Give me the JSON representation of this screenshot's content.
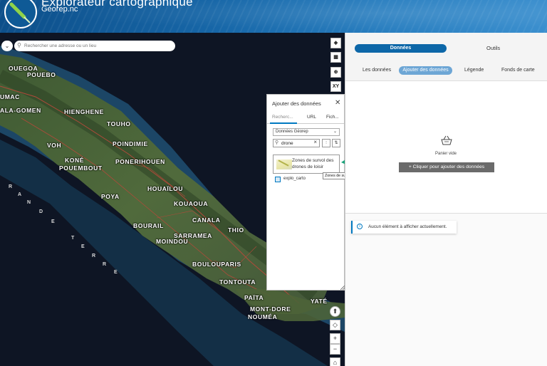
{
  "header": {
    "title": "Explorateur cartographique",
    "subtitle": "Géorep.nc"
  },
  "map": {
    "search_placeholder": "Rechercher une adresse ou un lieu",
    "search_toggle_icon": "chevron-down-icon",
    "tools": [
      {
        "name": "layers-icon",
        "glyph": "◈"
      },
      {
        "name": "qr-code-icon",
        "glyph": "▦"
      },
      {
        "name": "add-circle-icon",
        "glyph": "⊕"
      },
      {
        "name": "xy-button",
        "glyph": "XY"
      }
    ],
    "nav": [
      {
        "name": "compass-icon",
        "glyph": "⬆"
      },
      {
        "name": "locate-icon",
        "glyph": "◇"
      },
      {
        "name": "zoom-in-button",
        "glyph": "+"
      },
      {
        "name": "zoom-out-button",
        "glyph": "−"
      },
      {
        "name": "home-icon",
        "glyph": "⌂"
      }
    ],
    "places": [
      "OUEGOA",
      "POUEBO",
      "UMAC",
      "ALA-GOMEN",
      "HIENGHENE",
      "TOUHO",
      "VOH",
      "POINDIMIE",
      "KONÉ",
      "POUEMBOUT",
      "PONERIHOUEN",
      "POYA",
      "HOUAÏLOU",
      "KOUAOUA",
      "CANALA",
      "BOURAIL",
      "THIO",
      "SARRAMEA",
      "MOINDOU",
      "BOULOUPARIS",
      "TONTOUTA",
      "PAÏTA",
      "MONT-DORE",
      "NOUMÉA",
      "YATÉ"
    ],
    "grande_terre_letters": [
      "R",
      "A",
      "N",
      "D",
      "E",
      "T",
      "E",
      "R",
      "R",
      "E"
    ]
  },
  "add_data": {
    "title": "Ajouter des données",
    "tabs": [
      "Recherc...",
      "URL",
      "Fich..."
    ],
    "source": "Données Géorep",
    "search_value": "drone",
    "results": [
      {
        "name": "Zones de survol des drones de loisir"
      },
      {
        "name": "explo_carto"
      }
    ],
    "tooltip": "Zones de survol des drones de loisir"
  },
  "panel": {
    "top_tabs": [
      "Données",
      "Outils"
    ],
    "sub_tabs": [
      "Les données",
      "Ajouter des données",
      "Légende",
      "Fonds de carte"
    ],
    "basket_label": "Panier vide",
    "add_button": "Cliquer pour ajouter des données",
    "empty_notice": "Aucun élément à afficher actuellement."
  },
  "colors": {
    "header_blue": "#1767a8",
    "pill_blue": "#0d67a8",
    "active_subtab": "#6da6d5",
    "annotation_arrow": "#1aa37a",
    "button_gray": "#6b6b6b"
  }
}
